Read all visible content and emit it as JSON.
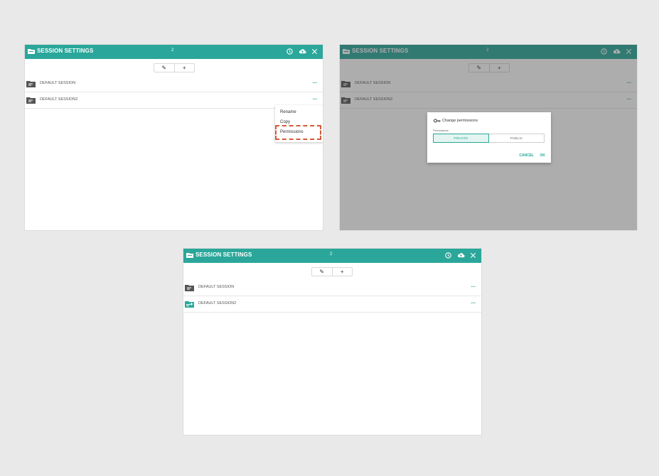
{
  "colors": {
    "accent": "#2aa79a",
    "highlight": "#d35a3a",
    "background": "#e9e9e9"
  },
  "header": {
    "title": "SESSION SETTINGS",
    "count": "2"
  },
  "header_icons": [
    "folder-icon",
    "history-icon",
    "cloud-upload-icon",
    "close-icon"
  ],
  "toolbar": {
    "edit_label": "✎",
    "add_label": "+"
  },
  "sessions": [
    {
      "label": "DEFAULT SESSION",
      "more": "···"
    },
    {
      "label": "DEFAULT SESSION2",
      "more": "···"
    }
  ],
  "context_menu": {
    "items": [
      "Rename",
      "Copy",
      "Permissions"
    ],
    "highlighted": "Permissions"
  },
  "permissions_dialog": {
    "title": "Change permissions",
    "field_label": "Permissions",
    "options": [
      "PRIVATE",
      "PUBLIC"
    ],
    "selected": "PRIVATE",
    "cancel_label": "CANCEL",
    "ok_label": "OK"
  }
}
